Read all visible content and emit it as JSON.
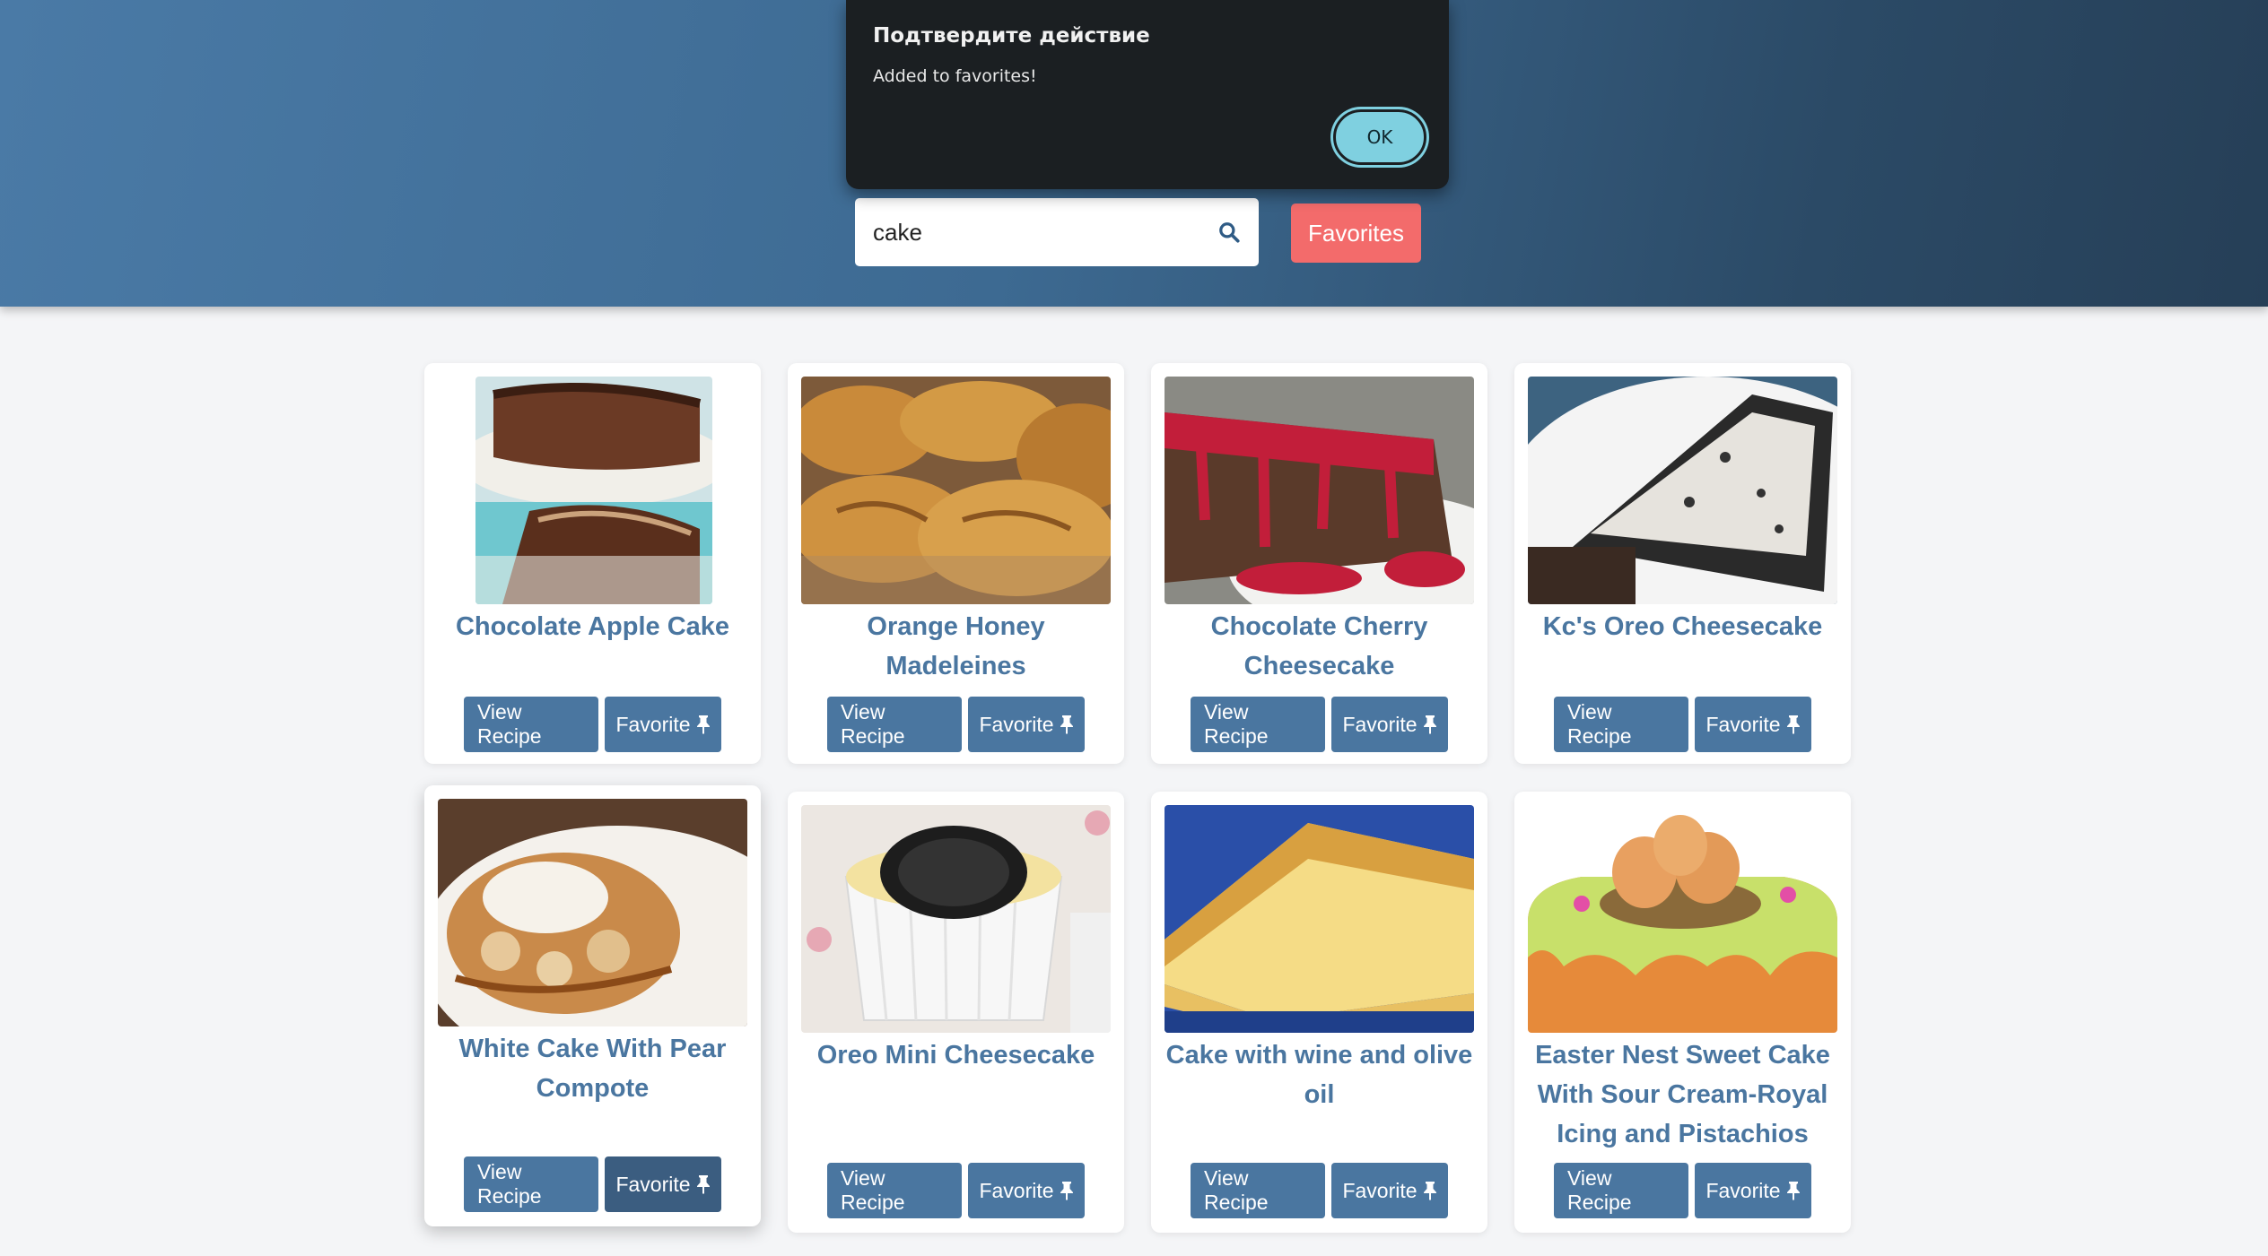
{
  "search": {
    "value": "cake"
  },
  "header": {
    "favorites_label": "Favorites"
  },
  "dialog": {
    "title": "Подтвердите действие",
    "message": "Added to favorites!",
    "ok_label": "OK"
  },
  "colors": {
    "link_blue": "#4a76a0",
    "favorites_red": "#f36b6b",
    "dialog_bg": "#1b1f22",
    "ok_cyan": "#7fd0e0"
  },
  "recipes": [
    {
      "title": "Chocolate Apple Cake",
      "view_label": "View Recipe",
      "fav_label": "Favorite"
    },
    {
      "title": "Orange Honey Madeleines",
      "view_label": "View Recipe",
      "fav_label": "Favorite"
    },
    {
      "title": "Chocolate Cherry Cheesecake",
      "view_label": "View Recipe",
      "fav_label": "Favorite"
    },
    {
      "title": "Kc's Oreo Cheesecake",
      "view_label": "View Recipe",
      "fav_label": "Favorite"
    },
    {
      "title": "White Cake With Pear Compote",
      "view_label": "View Recipe",
      "fav_label": "Favorite"
    },
    {
      "title": "Oreo Mini Cheesecake",
      "view_label": "View Recipe",
      "fav_label": "Favorite"
    },
    {
      "title": "Cake with wine and olive oil",
      "view_label": "View Recipe",
      "fav_label": "Favorite"
    },
    {
      "title": "Easter Nest Sweet Cake With Sour Cream-Royal Icing and Pistachios",
      "view_label": "View Recipe",
      "fav_label": "Favorite"
    }
  ]
}
